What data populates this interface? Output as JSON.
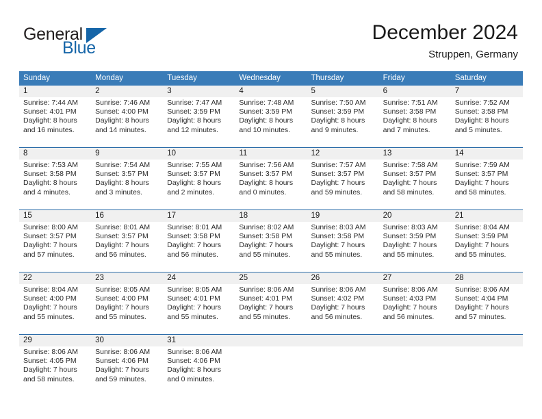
{
  "logo": {
    "word_top": "General",
    "word_bottom": "Blue",
    "triangle_color": "#1565a8",
    "top_color": "#231f20"
  },
  "header": {
    "month_title": "December 2024",
    "location": "Struppen, Germany"
  },
  "theme": {
    "header_blue": "#3a7cb8",
    "row_divider_blue": "#2a6ba8",
    "day_number_band": "#f0f0f0",
    "text": "#1a1a1a"
  },
  "calendar": {
    "weekday_headers": [
      "Sunday",
      "Monday",
      "Tuesday",
      "Wednesday",
      "Thursday",
      "Friday",
      "Saturday"
    ],
    "weeks": [
      [
        {
          "day": "1",
          "lines": [
            "Sunrise: 7:44 AM",
            "Sunset: 4:01 PM",
            "Daylight: 8 hours",
            "and 16 minutes."
          ]
        },
        {
          "day": "2",
          "lines": [
            "Sunrise: 7:46 AM",
            "Sunset: 4:00 PM",
            "Daylight: 8 hours",
            "and 14 minutes."
          ]
        },
        {
          "day": "3",
          "lines": [
            "Sunrise: 7:47 AM",
            "Sunset: 3:59 PM",
            "Daylight: 8 hours",
            "and 12 minutes."
          ]
        },
        {
          "day": "4",
          "lines": [
            "Sunrise: 7:48 AM",
            "Sunset: 3:59 PM",
            "Daylight: 8 hours",
            "and 10 minutes."
          ]
        },
        {
          "day": "5",
          "lines": [
            "Sunrise: 7:50 AM",
            "Sunset: 3:59 PM",
            "Daylight: 8 hours",
            "and 9 minutes."
          ]
        },
        {
          "day": "6",
          "lines": [
            "Sunrise: 7:51 AM",
            "Sunset: 3:58 PM",
            "Daylight: 8 hours",
            "and 7 minutes."
          ]
        },
        {
          "day": "7",
          "lines": [
            "Sunrise: 7:52 AM",
            "Sunset: 3:58 PM",
            "Daylight: 8 hours",
            "and 5 minutes."
          ]
        }
      ],
      [
        {
          "day": "8",
          "lines": [
            "Sunrise: 7:53 AM",
            "Sunset: 3:58 PM",
            "Daylight: 8 hours",
            "and 4 minutes."
          ]
        },
        {
          "day": "9",
          "lines": [
            "Sunrise: 7:54 AM",
            "Sunset: 3:57 PM",
            "Daylight: 8 hours",
            "and 3 minutes."
          ]
        },
        {
          "day": "10",
          "lines": [
            "Sunrise: 7:55 AM",
            "Sunset: 3:57 PM",
            "Daylight: 8 hours",
            "and 2 minutes."
          ]
        },
        {
          "day": "11",
          "lines": [
            "Sunrise: 7:56 AM",
            "Sunset: 3:57 PM",
            "Daylight: 8 hours",
            "and 0 minutes."
          ]
        },
        {
          "day": "12",
          "lines": [
            "Sunrise: 7:57 AM",
            "Sunset: 3:57 PM",
            "Daylight: 7 hours",
            "and 59 minutes."
          ]
        },
        {
          "day": "13",
          "lines": [
            "Sunrise: 7:58 AM",
            "Sunset: 3:57 PM",
            "Daylight: 7 hours",
            "and 58 minutes."
          ]
        },
        {
          "day": "14",
          "lines": [
            "Sunrise: 7:59 AM",
            "Sunset: 3:57 PM",
            "Daylight: 7 hours",
            "and 58 minutes."
          ]
        }
      ],
      [
        {
          "day": "15",
          "lines": [
            "Sunrise: 8:00 AM",
            "Sunset: 3:57 PM",
            "Daylight: 7 hours",
            "and 57 minutes."
          ]
        },
        {
          "day": "16",
          "lines": [
            "Sunrise: 8:01 AM",
            "Sunset: 3:57 PM",
            "Daylight: 7 hours",
            "and 56 minutes."
          ]
        },
        {
          "day": "17",
          "lines": [
            "Sunrise: 8:01 AM",
            "Sunset: 3:58 PM",
            "Daylight: 7 hours",
            "and 56 minutes."
          ]
        },
        {
          "day": "18",
          "lines": [
            "Sunrise: 8:02 AM",
            "Sunset: 3:58 PM",
            "Daylight: 7 hours",
            "and 55 minutes."
          ]
        },
        {
          "day": "19",
          "lines": [
            "Sunrise: 8:03 AM",
            "Sunset: 3:58 PM",
            "Daylight: 7 hours",
            "and 55 minutes."
          ]
        },
        {
          "day": "20",
          "lines": [
            "Sunrise: 8:03 AM",
            "Sunset: 3:59 PM",
            "Daylight: 7 hours",
            "and 55 minutes."
          ]
        },
        {
          "day": "21",
          "lines": [
            "Sunrise: 8:04 AM",
            "Sunset: 3:59 PM",
            "Daylight: 7 hours",
            "and 55 minutes."
          ]
        }
      ],
      [
        {
          "day": "22",
          "lines": [
            "Sunrise: 8:04 AM",
            "Sunset: 4:00 PM",
            "Daylight: 7 hours",
            "and 55 minutes."
          ]
        },
        {
          "day": "23",
          "lines": [
            "Sunrise: 8:05 AM",
            "Sunset: 4:00 PM",
            "Daylight: 7 hours",
            "and 55 minutes."
          ]
        },
        {
          "day": "24",
          "lines": [
            "Sunrise: 8:05 AM",
            "Sunset: 4:01 PM",
            "Daylight: 7 hours",
            "and 55 minutes."
          ]
        },
        {
          "day": "25",
          "lines": [
            "Sunrise: 8:06 AM",
            "Sunset: 4:01 PM",
            "Daylight: 7 hours",
            "and 55 minutes."
          ]
        },
        {
          "day": "26",
          "lines": [
            "Sunrise: 8:06 AM",
            "Sunset: 4:02 PM",
            "Daylight: 7 hours",
            "and 56 minutes."
          ]
        },
        {
          "day": "27",
          "lines": [
            "Sunrise: 8:06 AM",
            "Sunset: 4:03 PM",
            "Daylight: 7 hours",
            "and 56 minutes."
          ]
        },
        {
          "day": "28",
          "lines": [
            "Sunrise: 8:06 AM",
            "Sunset: 4:04 PM",
            "Daylight: 7 hours",
            "and 57 minutes."
          ]
        }
      ],
      [
        {
          "day": "29",
          "lines": [
            "Sunrise: 8:06 AM",
            "Sunset: 4:05 PM",
            "Daylight: 7 hours",
            "and 58 minutes."
          ]
        },
        {
          "day": "30",
          "lines": [
            "Sunrise: 8:06 AM",
            "Sunset: 4:06 PM",
            "Daylight: 7 hours",
            "and 59 minutes."
          ]
        },
        {
          "day": "31",
          "lines": [
            "Sunrise: 8:06 AM",
            "Sunset: 4:06 PM",
            "Daylight: 8 hours",
            "and 0 minutes."
          ]
        },
        {
          "day": "",
          "lines": []
        },
        {
          "day": "",
          "lines": []
        },
        {
          "day": "",
          "lines": []
        },
        {
          "day": "",
          "lines": []
        }
      ]
    ]
  }
}
